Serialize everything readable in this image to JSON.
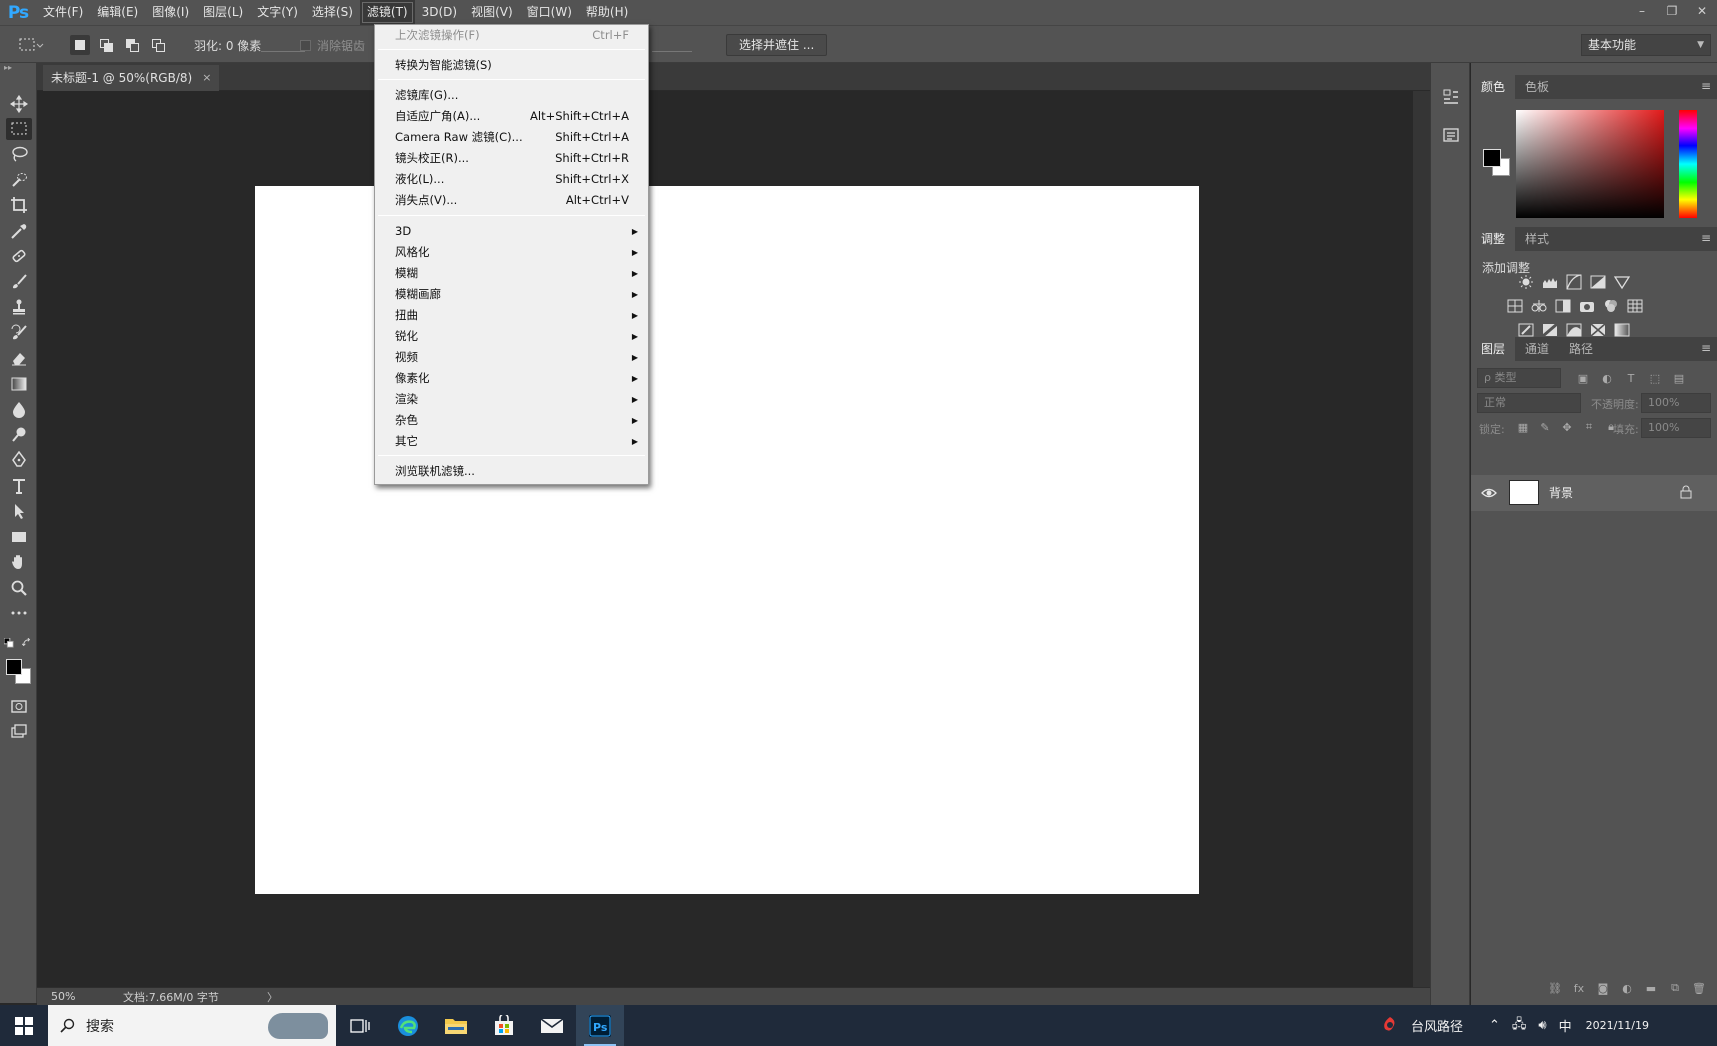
{
  "app": {
    "logo": "Ps"
  },
  "menubar": {
    "items": [
      "文件(F)",
      "编辑(E)",
      "图像(I)",
      "图层(L)",
      "文字(Y)",
      "选择(S)",
      "滤镜(T)",
      "3D(D)",
      "视图(V)",
      "窗口(W)",
      "帮助(H)"
    ],
    "active_index": 6
  },
  "window_controls": {
    "minimize": "–",
    "restore": "❐",
    "close": "✕"
  },
  "options": {
    "feather_label": "羽化: 0 像素",
    "antialias_label": "消除锯齿",
    "select_mask_button": "选择并遮住 ...",
    "workspace": "基本功能"
  },
  "document": {
    "tab_title": "未标题-1 @ 50%(RGB/8)",
    "tab_close": "×"
  },
  "status": {
    "zoom": "50%",
    "doc_info": "文档:7.66M/0 字节",
    "arrow": "〉"
  },
  "filter_menu": {
    "last_filter": {
      "label": "上次滤镜操作(F)",
      "shortcut": "Ctrl+F"
    },
    "smart_filter": "转换为智能滤镜(S)",
    "group1": [
      {
        "label": "滤镜库(G)...",
        "shortcut": ""
      },
      {
        "label": "自适应广角(A)...",
        "shortcut": "Alt+Shift+Ctrl+A"
      },
      {
        "label": "Camera Raw 滤镜(C)...",
        "shortcut": "Shift+Ctrl+A"
      },
      {
        "label": "镜头校正(R)...",
        "shortcut": "Shift+Ctrl+R"
      },
      {
        "label": "液化(L)...",
        "shortcut": "Shift+Ctrl+X"
      },
      {
        "label": "消失点(V)...",
        "shortcut": "Alt+Ctrl+V"
      }
    ],
    "submenus": [
      "3D",
      "风格化",
      "模糊",
      "模糊画廊",
      "扭曲",
      "锐化",
      "视频",
      "像素化",
      "渲染",
      "杂色",
      "其它"
    ],
    "browse_online": "浏览联机滤镜..."
  },
  "panels": {
    "color_tabs": [
      "颜色",
      "色板"
    ],
    "adjust_tabs": [
      "调整",
      "样式"
    ],
    "adjust_title": "添加调整",
    "layers_tabs": [
      "图层",
      "通道",
      "路径"
    ],
    "kind_filter": "ρ 类型",
    "blend_mode": "正常",
    "opacity_label": "不透明度:",
    "opacity_value": "100%",
    "lock_label": "锁定:",
    "fill_label": "填充:",
    "fill_value": "100%",
    "layer_name": "背景"
  },
  "taskbar": {
    "search_placeholder": "搜索",
    "weather": "台风路径",
    "ime": "中",
    "time": "",
    "date": "2021/11/19"
  },
  "colors": {
    "ps_blue": "#31a8ff",
    "ui_gray": "#535353",
    "canvas_bg": "#282828",
    "menu_bg": "#f0f0f0"
  }
}
